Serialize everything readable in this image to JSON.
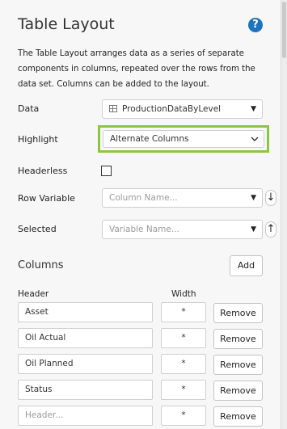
{
  "panel": {
    "title": "Table Layout",
    "help_icon": "?",
    "description": "The Table Layout arranges data as a series of separate components in columns, repeated over the rows from the data set. Columns can be added to the layout."
  },
  "fields": {
    "data": {
      "label": "Data",
      "value": "ProductionDataByLevel"
    },
    "highlight": {
      "label": "Highlight",
      "value": "Alternate Columns"
    },
    "headerless": {
      "label": "Headerless",
      "checked": false
    },
    "row_variable": {
      "label": "Row Variable",
      "placeholder": "Column Name...",
      "sort_icon": "↓"
    },
    "selected": {
      "label": "Selected",
      "placeholder": "Variable Name...",
      "sort_icon": "↑"
    }
  },
  "columns": {
    "title": "Columns",
    "add_label": "Add",
    "header_label": "Header",
    "width_label": "Width",
    "remove_label": "Remove",
    "rows": [
      {
        "header": "Asset",
        "width": "*"
      },
      {
        "header": "Oil Actual",
        "width": "*"
      },
      {
        "header": "Oil Planned",
        "width": "*"
      },
      {
        "header": "Status",
        "width": "*"
      },
      {
        "header": "Header...",
        "width": "*",
        "placeholder": true
      }
    ]
  },
  "colors": {
    "highlight_border": "#8cc63f",
    "help_icon_bg": "#1e73be"
  }
}
